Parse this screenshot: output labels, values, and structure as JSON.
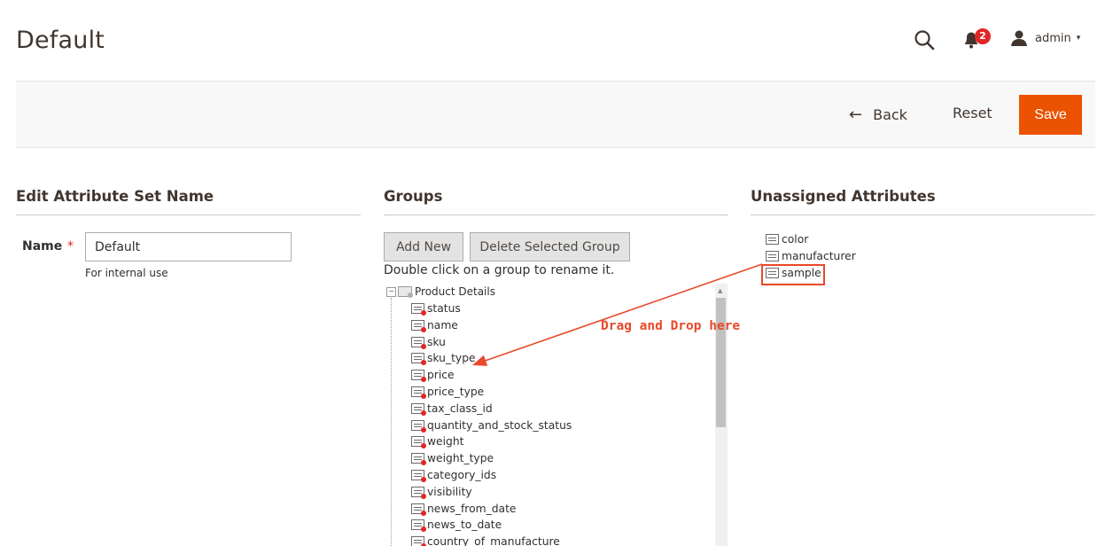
{
  "header": {
    "title": "Default",
    "notifications_count": "2",
    "username": "admin",
    "caret": "▾"
  },
  "toolbar": {
    "back_label": "Back",
    "back_arrow": "←",
    "reset_label": "Reset",
    "save_label": "Save"
  },
  "edit_section": {
    "title": "Edit Attribute Set Name",
    "name_label": "Name",
    "required_mark": "*",
    "name_value": "Default",
    "note": "For internal use"
  },
  "groups_section": {
    "title": "Groups",
    "add_new_label": "Add New",
    "delete_label": "Delete Selected Group",
    "hint": "Double click on a group to rename it.",
    "root_group": "Product Details",
    "toggle": "−",
    "attributes": [
      "status",
      "name",
      "sku",
      "sku_type",
      "price",
      "price_type",
      "tax_class_id",
      "quantity_and_stock_status",
      "weight",
      "weight_type",
      "category_ids",
      "visibility",
      "news_from_date",
      "news_to_date",
      "country_of_manufacture"
    ]
  },
  "unassigned_section": {
    "title": "Unassigned Attributes",
    "attributes": [
      "color",
      "manufacturer",
      "sample"
    ]
  },
  "annotation": {
    "text": "Drag and Drop here",
    "color": "#e8492a"
  },
  "colors": {
    "save_button": "#eb5202",
    "badge": "#e22626"
  },
  "icons": {
    "search": "search-icon",
    "bell": "bell-icon",
    "user": "user-icon"
  }
}
